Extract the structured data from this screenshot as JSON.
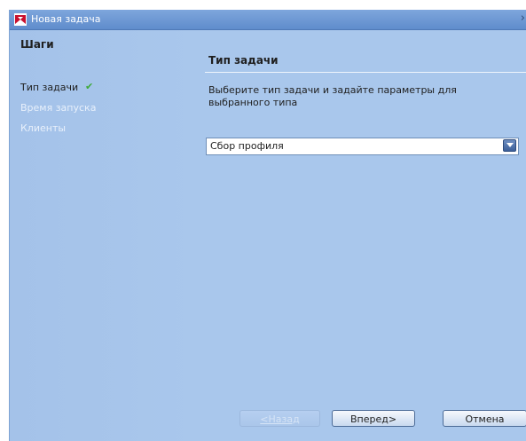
{
  "window": {
    "title": "Новая задача",
    "close_label": "›"
  },
  "steps": {
    "title": "Шаги",
    "items": [
      {
        "label": "Тип задачи",
        "state": "completed"
      },
      {
        "label": "Время запуска",
        "state": "disabled"
      },
      {
        "label": "Клиенты",
        "state": "disabled"
      }
    ],
    "check_glyph": "✔"
  },
  "main": {
    "section_title": "Тип задачи",
    "description": "Выберите тип задачи и задайте параметры для выбранного типа",
    "task_type": {
      "selected": "Сбор профиля"
    }
  },
  "buttons": {
    "back": "<Назад",
    "next": "Вперед>",
    "cancel": "Отмена"
  },
  "colors": {
    "background": "#a9c7ec",
    "titlebar": "#6a97d4",
    "completed_check": "#3faa3a"
  }
}
